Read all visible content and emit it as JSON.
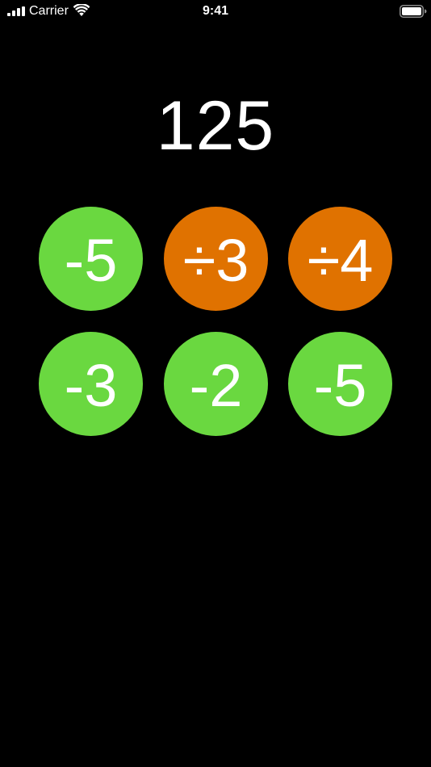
{
  "status_bar": {
    "carrier": "Carrier",
    "time": "9:41",
    "icons": [
      "signal-icon",
      "wifi-icon",
      "battery-icon"
    ]
  },
  "game": {
    "target": "125",
    "operations": [
      {
        "label": "-5",
        "color": "#6ad840"
      },
      {
        "label": "÷3",
        "color": "#e07200"
      },
      {
        "label": "÷4",
        "color": "#e07200"
      },
      {
        "label": "-3",
        "color": "#6ad840"
      },
      {
        "label": "-2",
        "color": "#6ad840"
      },
      {
        "label": "-5",
        "color": "#6ad840"
      }
    ]
  },
  "colors": {
    "background": "#000000",
    "text": "#ffffff",
    "subtract": "#6ad840",
    "divide": "#e07200"
  }
}
